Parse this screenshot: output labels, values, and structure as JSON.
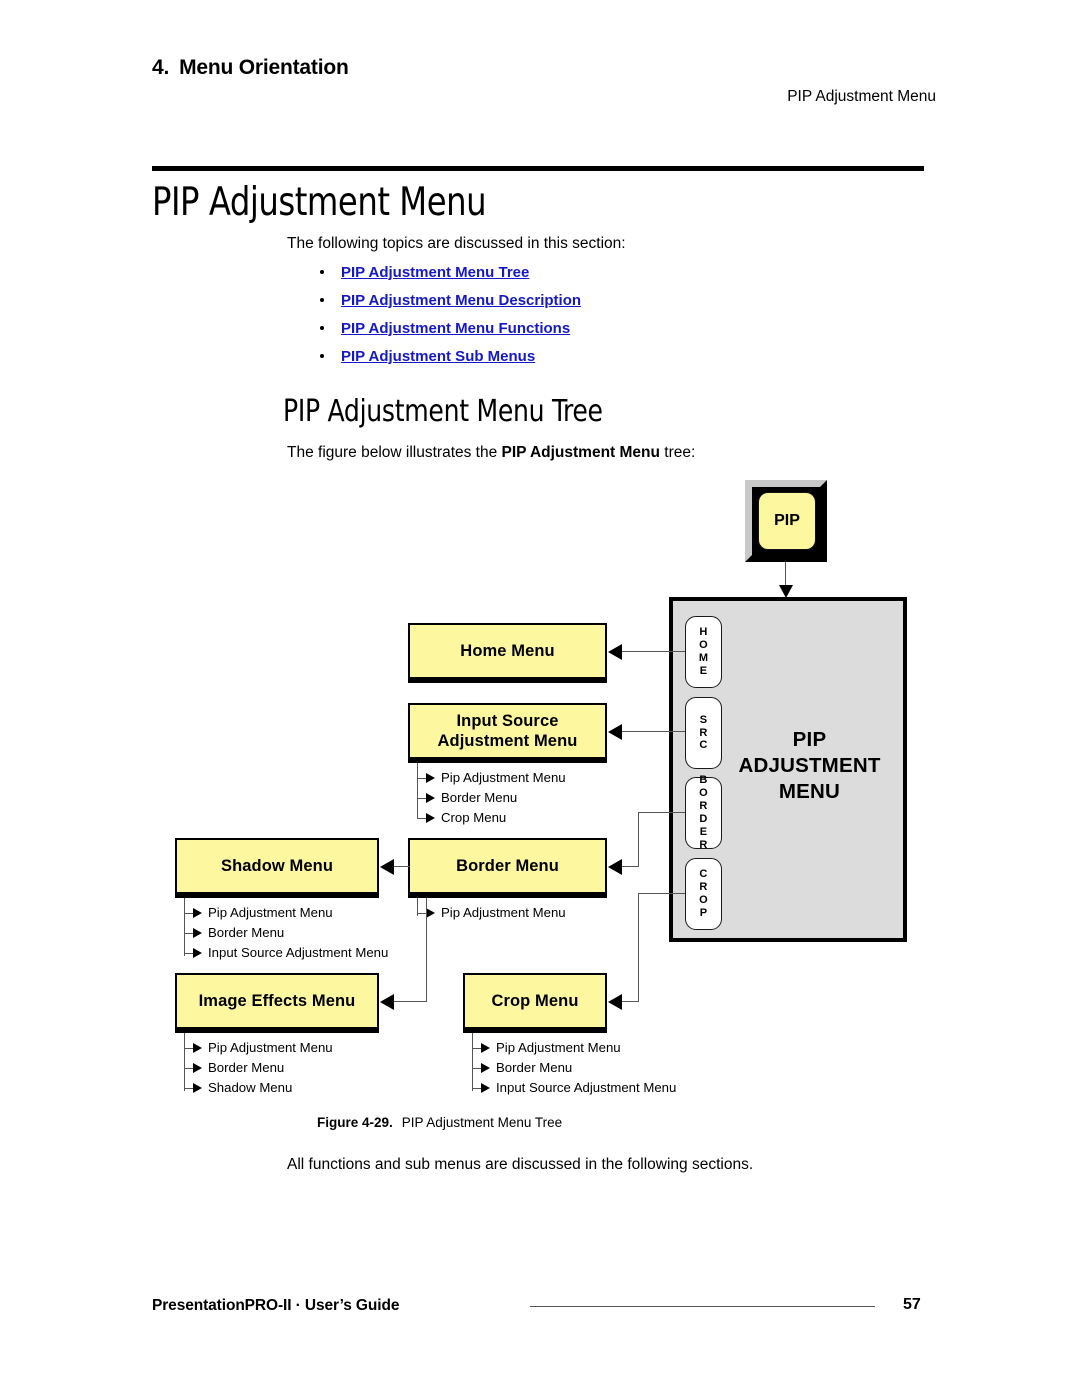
{
  "header": {
    "chapter_number": "4.",
    "chapter_title": "Menu Orientation",
    "running_head": "PIP Adjustment Menu"
  },
  "page_title": "PIP Adjustment Menu",
  "intro_text": "The following topics are discussed in this section:",
  "toc_links": [
    {
      "label": "PIP Adjustment Menu Tree"
    },
    {
      "label": "PIP Adjustment Menu Description"
    },
    {
      "label": "PIP Adjustment Menu Functions"
    },
    {
      "label": "PIP Adjustment Sub Menus"
    }
  ],
  "section_heading": "PIP Adjustment Menu Tree",
  "figure_lead": {
    "prefix": "The figure below illustrates the ",
    "emphasis": "PIP Adjustment Menu",
    "suffix": " tree:"
  },
  "figure": {
    "hard_key_label": "PIP",
    "panel_title_lines": [
      "PIP",
      "ADJUSTMENT",
      "MENU"
    ],
    "panel_buttons": [
      {
        "name": "HOME",
        "letters": [
          "H",
          "O",
          "M",
          "E"
        ]
      },
      {
        "name": "SRC",
        "letters": [
          "S",
          "R",
          "C"
        ]
      },
      {
        "name": "BORDER",
        "letters": [
          "B",
          "O",
          "R",
          "D",
          "E",
          "R"
        ]
      },
      {
        "name": "CROP",
        "letters": [
          "C",
          "R",
          "O",
          "P"
        ]
      }
    ],
    "menu_boxes": [
      {
        "id": "home-menu",
        "title": "Home Menu",
        "title_lines": [
          "Home Menu"
        ],
        "sub_items": []
      },
      {
        "id": "input-source-adjustment-menu",
        "title": "Input Source Adjustment Menu",
        "title_lines": [
          "Input Source",
          "Adjustment Menu"
        ],
        "sub_items": [
          "Pip Adjustment Menu",
          "Border Menu",
          "Crop Menu"
        ]
      },
      {
        "id": "shadow-menu",
        "title": "Shadow Menu",
        "title_lines": [
          "Shadow Menu"
        ],
        "sub_items": [
          "Pip Adjustment Menu",
          "Border Menu",
          "Input Source Adjustment Menu"
        ]
      },
      {
        "id": "border-menu",
        "title": "Border Menu",
        "title_lines": [
          "Border Menu"
        ],
        "sub_items": [
          "Pip Adjustment Menu"
        ]
      },
      {
        "id": "image-effects-menu",
        "title": "Image Effects Menu",
        "title_lines": [
          "Image Effects Menu"
        ],
        "sub_items": [
          "Pip Adjustment Menu",
          "Border Menu",
          "Shadow Menu"
        ]
      },
      {
        "id": "crop-menu",
        "title": "Crop Menu",
        "title_lines": [
          "Crop Menu"
        ],
        "sub_items": [
          "Pip Adjustment Menu",
          "Border Menu",
          "Input Source Adjustment Menu"
        ]
      }
    ]
  },
  "caption": {
    "number": "Figure 4-29.",
    "text": "PIP Adjustment Menu Tree"
  },
  "closing_text": "All functions and sub menus are discussed in the following sections.",
  "footer": {
    "document": "PresentationPRO-II  ·  User’s Guide",
    "page_number": "57"
  },
  "colors": {
    "link": "#1418c8",
    "menu_box_fill": "#FDF89F",
    "panel_fill": "#DCDCDC",
    "button_fill": "#FFFFFF",
    "outline": "#000000"
  }
}
